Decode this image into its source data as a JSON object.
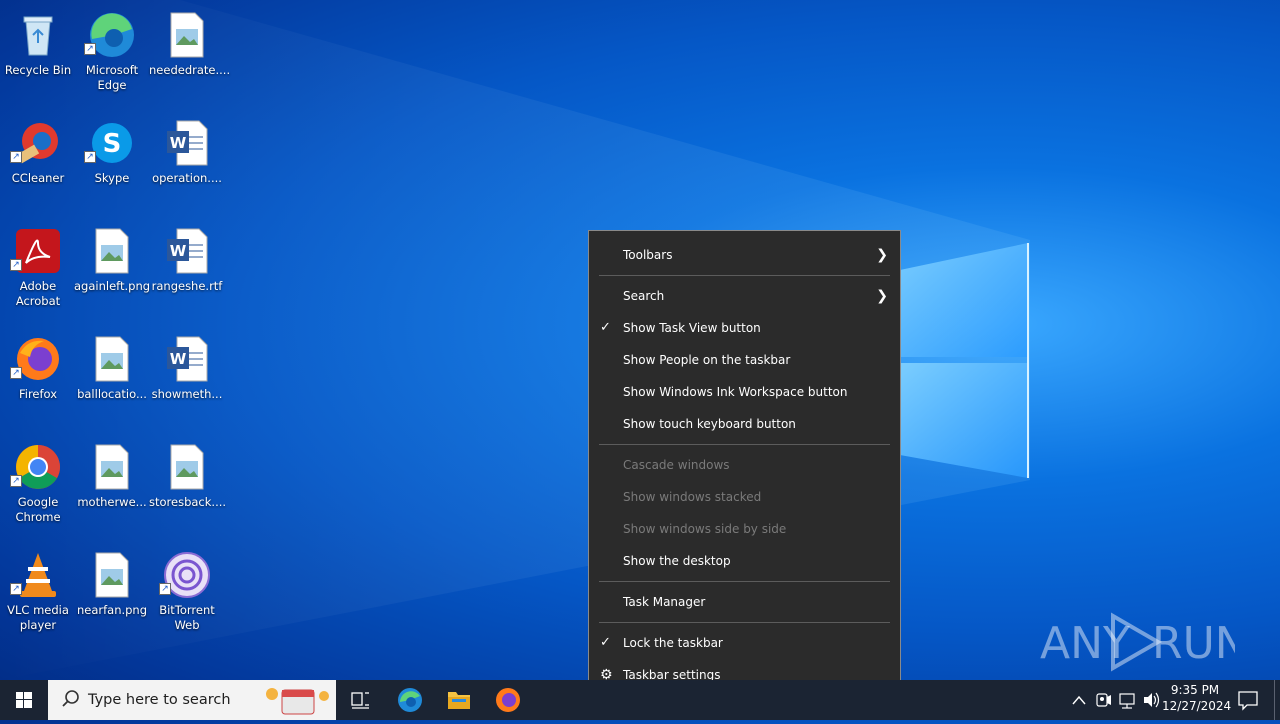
{
  "desktop": {
    "icons": [
      {
        "label": "Recycle Bin",
        "icon": "recycle-bin-icon"
      },
      {
        "label": "Microsoft Edge",
        "icon": "edge-icon"
      },
      {
        "label": "neededrate....",
        "icon": "image-file-icon"
      },
      {
        "label": "CCleaner",
        "icon": "ccleaner-icon"
      },
      {
        "label": "Skype",
        "icon": "skype-icon"
      },
      {
        "label": "operation....",
        "icon": "word-document-icon"
      },
      {
        "label": "Adobe Acrobat",
        "icon": "acrobat-icon"
      },
      {
        "label": "againleft.png",
        "icon": "image-file-icon"
      },
      {
        "label": "rangeshe.rtf",
        "icon": "word-document-icon"
      },
      {
        "label": "Firefox",
        "icon": "firefox-icon"
      },
      {
        "label": "balllocatio...",
        "icon": "image-file-icon"
      },
      {
        "label": "showmeth...",
        "icon": "word-document-icon"
      },
      {
        "label": "Google Chrome",
        "icon": "chrome-icon"
      },
      {
        "label": "motherwe...",
        "icon": "image-file-icon"
      },
      {
        "label": "storesback....",
        "icon": "image-file-icon"
      },
      {
        "label": "VLC media player",
        "icon": "vlc-icon"
      },
      {
        "label": "nearfan.png",
        "icon": "image-file-icon"
      },
      {
        "label": "BitTorrent Web",
        "icon": "bittorrent-icon"
      }
    ]
  },
  "context_menu": {
    "toolbars": "Toolbars",
    "search": "Search",
    "show_task_view": "Show Task View button",
    "show_people": "Show People on the taskbar",
    "show_ink": "Show Windows Ink Workspace button",
    "show_touch_keyboard": "Show touch keyboard button",
    "cascade": "Cascade windows",
    "stacked": "Show windows stacked",
    "side_by_side": "Show windows side by side",
    "show_desktop": "Show the desktop",
    "task_manager": "Task Manager",
    "lock_taskbar": "Lock the taskbar",
    "taskbar_settings": "Taskbar settings"
  },
  "watermark": {
    "text": "ANY RUN"
  },
  "taskbar": {
    "search_placeholder": "Type here to search",
    "time": "9:35 PM",
    "date": "12/27/2024"
  },
  "colors": {
    "menu_bg": "#2b2b2b",
    "taskbar_bg": "#1b2433",
    "disabled_text": "#7a7a7a"
  }
}
